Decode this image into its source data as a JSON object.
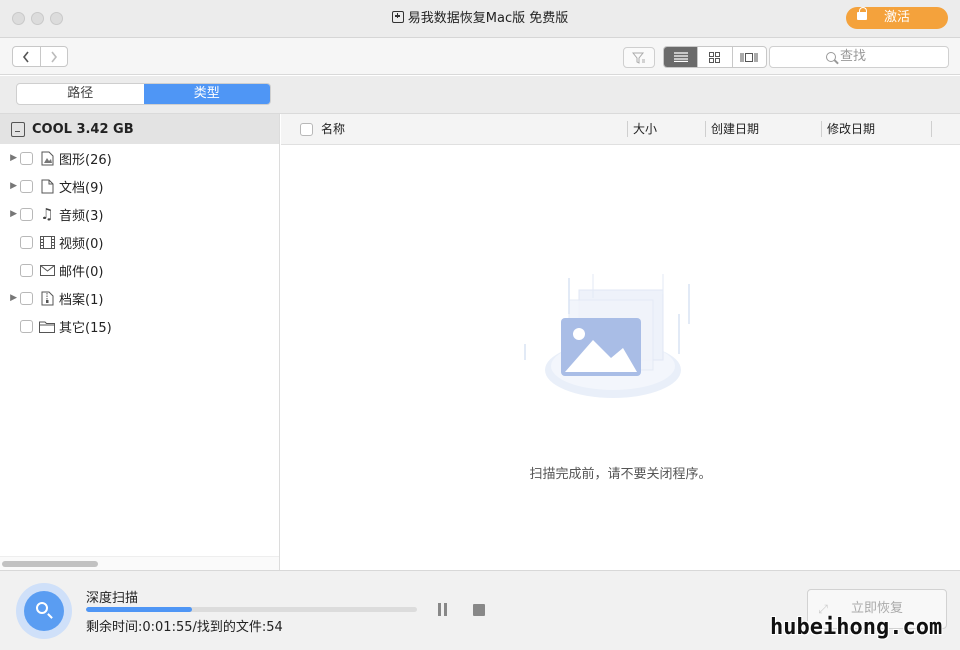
{
  "window": {
    "title": "易我数据恢复Mac版 免费版",
    "activate_label": "激活",
    "accent": "#f4a23c"
  },
  "toolbar": {
    "back_icon": "chevron-left-icon",
    "forward_icon": "chevron-right-icon",
    "search_placeholder": "查找",
    "views": [
      "list-view-icon",
      "grid-view-icon",
      "coverflow-view-icon"
    ],
    "active_view": "list"
  },
  "segments": {
    "items": [
      "路径",
      "类型"
    ],
    "active": "类型",
    "active_color": "#4f96f5"
  },
  "sidebar": {
    "drive_label": "COOL 3.42 GB",
    "items": [
      {
        "label": "图形(26)",
        "expandable": true,
        "icon": "image-file-icon"
      },
      {
        "label": "文档(9)",
        "expandable": true,
        "icon": "document-icon"
      },
      {
        "label": "音频(3)",
        "expandable": true,
        "icon": "music-note-icon"
      },
      {
        "label": "视频(0)",
        "expandable": false,
        "icon": "film-icon"
      },
      {
        "label": "邮件(0)",
        "expandable": false,
        "icon": "mail-icon"
      },
      {
        "label": "档案(1)",
        "expandable": true,
        "icon": "archive-icon"
      },
      {
        "label": "其它(15)",
        "expandable": false,
        "icon": "folder-icon"
      }
    ]
  },
  "table": {
    "columns": [
      "名称",
      "大小",
      "创建日期",
      "修改日期"
    ],
    "rows": [],
    "empty_message": "扫描完成前，请不要关闭程序。"
  },
  "scan": {
    "title": "深度扫描",
    "progress": 0.32,
    "status": "剩余时间:0:01:55/找到的文件:54",
    "recover_label": "立即恢复"
  },
  "watermark": "hubeihong.com"
}
